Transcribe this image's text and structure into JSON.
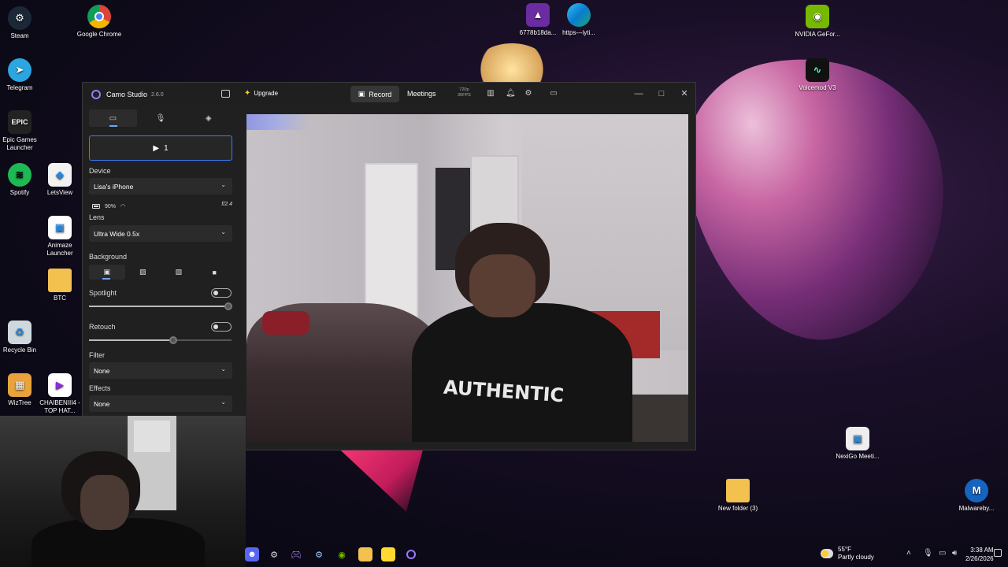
{
  "desktop": {
    "icons": [
      {
        "label": "Steam",
        "icon": "steam-icon",
        "color": "#1b2838"
      },
      {
        "label": "Google Chrome",
        "icon": "chrome-icon",
        "color": "#db4437"
      },
      {
        "label": "6778b18da...",
        "icon": "image-file-icon",
        "color": "#6a2ca0"
      },
      {
        "label": "https---iyti...",
        "icon": "edge-icon",
        "color": "#0a7bd1"
      },
      {
        "label": "NVIDIA GeFor...",
        "icon": "nvidia-icon",
        "color": "#76b900"
      },
      {
        "label": "Telegram",
        "icon": "telegram-icon",
        "color": "#2ca5e0"
      },
      {
        "label": "Voicemod V3",
        "icon": "voicemod-icon",
        "color": "#111111"
      },
      {
        "label": "Epic Games Launcher",
        "icon": "epic-games-icon",
        "color": "#222222"
      },
      {
        "label": "Spotify",
        "icon": "spotify-icon",
        "color": "#1db954"
      },
      {
        "label": "LetsView",
        "icon": "letsview-icon",
        "color": "#f2f2f2"
      },
      {
        "label": "Animaze Launcher",
        "icon": "animaze-icon",
        "color": "#ffffff"
      },
      {
        "label": "BTC",
        "icon": "folder-icon",
        "color": "#f2c14e"
      },
      {
        "label": "Recycle Bin",
        "icon": "recycle-bin-icon",
        "color": "#cfd8dc"
      },
      {
        "label": "WizTree",
        "icon": "wiztree-icon",
        "color": "#e8a33d"
      },
      {
        "label": "CHAIBENIII4 - TOP HAT...",
        "icon": "video-file-icon",
        "color": "#ffffff"
      },
      {
        "label": "NexiGo Meeti...",
        "icon": "nexigo-icon",
        "color": "#eeeeee"
      },
      {
        "label": "New folder (3)",
        "icon": "folder-icon",
        "color": "#f2c14e"
      },
      {
        "label": "Malwareby...",
        "icon": "malwarebytes-icon",
        "color": "#1565c0"
      }
    ]
  },
  "camo": {
    "app_name": "Camo Studio",
    "version": "2.6.0",
    "upgrade_label": "Upgrade",
    "record_label": "Record",
    "meetings_label": "Meetings",
    "resolution": "720p",
    "fps": "30FPS",
    "camera_button_label": "1",
    "device_label": "Device",
    "device_value": "Lisa's iPhone",
    "battery": "90%",
    "aperture": "f/2.4",
    "lens_label": "Lens",
    "lens_value": "Ultra Wide 0.5x",
    "background_label": "Background",
    "spotlight_label": "Spotlight",
    "spotlight_level": 0.98,
    "retouch_label": "Retouch",
    "retouch_level": 0.59,
    "filter_label": "Filter",
    "filter_value": "None",
    "effects_label": "Effects",
    "effects_value": "None",
    "shirt_text": "AUTHENTIC",
    "accent_color": "#3d7cff"
  },
  "taskbar": {
    "weather_temp": "55°F",
    "weather_desc": "Partly cloudy",
    "time": "3:38 AM",
    "date": "2/26/2026",
    "apps": [
      "discord-icon",
      "settings-icon",
      "game-controller-icon",
      "steam-icon",
      "nvidia-icon",
      "file-explorer-icon",
      "sticky-notes-icon",
      "camo-icon"
    ]
  }
}
